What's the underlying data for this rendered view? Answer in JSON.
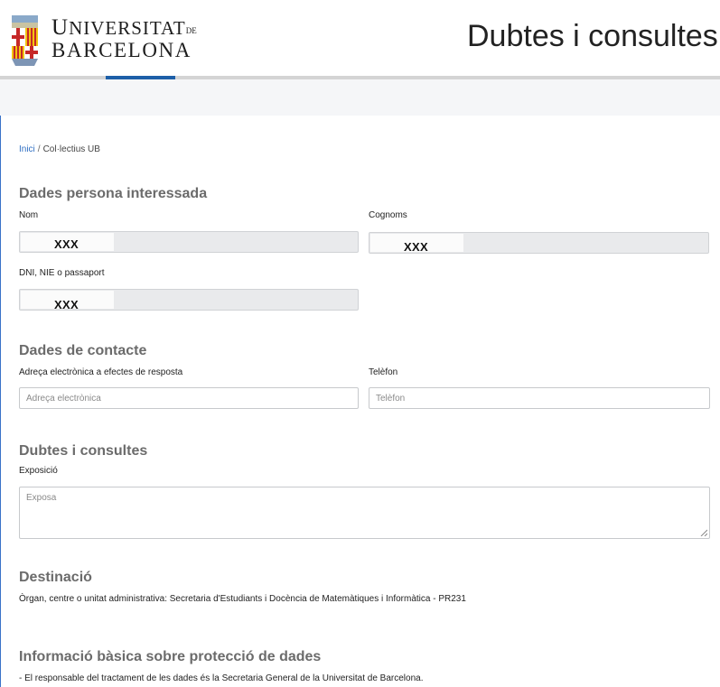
{
  "header": {
    "university_line1_a": "U",
    "university_line1_b": "NIVERSITAT",
    "university_line1_de": "DE",
    "university_line2": "BARCELONA",
    "page_title": "Dubtes i consultes"
  },
  "breadcrumb": {
    "home": "Inici",
    "separator": "/",
    "current": "Col·lectius UB"
  },
  "personal": {
    "title": "Dades persona interessada",
    "name_label": "Nom",
    "name_value": "XXX",
    "surname_label": "Cognoms",
    "surname_value": "XXX",
    "id_label": "DNI, NIE o passaport",
    "id_value": "XXX"
  },
  "contact": {
    "title": "Dades de contacte",
    "email_label": "Adreça electrònica a efectes de resposta",
    "email_placeholder": "Adreça electrònica",
    "phone_label": "Telèfon",
    "phone_placeholder": "Telèfon"
  },
  "query": {
    "title": "Dubtes i consultes",
    "exposition_label": "Exposició",
    "exposition_placeholder": "Exposa"
  },
  "destination": {
    "title": "Destinació",
    "text": "Òrgan, centre o unitat administrativa: Secretaria d'Estudiants i Docència de Matemàtiques i Informàtica - PR231"
  },
  "privacy": {
    "title": "Informació bàsica sobre protecció de dades",
    "line1": "- El responsable del tractament de les dades és la Secretaria General de la Universitat de Barcelona."
  },
  "colors": {
    "accent": "#1d5fa8",
    "link": "#2f6fc3",
    "section_title": "#6b6b6b",
    "readonly_bg": "#e9eaec"
  }
}
